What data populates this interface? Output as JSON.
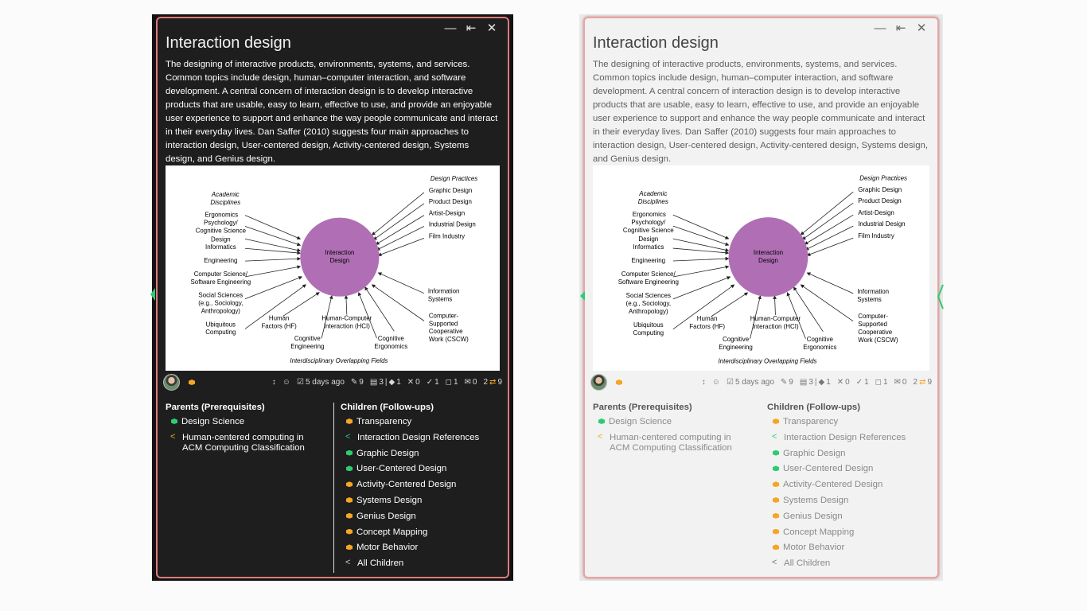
{
  "window_controls": {
    "minimize": "—",
    "restore": "⇤",
    "close": "✕"
  },
  "node": {
    "title": "Interaction design",
    "description": "The designing of interactive products, environments, systems, and services. Common topics include design, human–computer interaction, and software development. A central concern of interaction design is to develop interactive products that are usable, easy to learn, effective to use, and provide an enjoyable user experience to support and enhance the way people communicate and interact in their everyday lives. Dan Saffer (2010) suggests four main approaches to interaction design, User-centered design, Activity-centered design, Systems design, and Genius design."
  },
  "figure": {
    "center_line1": "Interaction",
    "center_line2": "Design",
    "academic_heading1": "Academic",
    "academic_heading2": "Disciplines",
    "practices_heading": "Design Practices",
    "fields_heading": "Interdisciplinary Overlapping Fields",
    "left_labels": [
      "Ergonomics",
      "Psychology/",
      "Cognitive Science",
      "Design",
      "Informatics",
      "Engineering",
      "Computer Science/",
      "Software Engineering",
      "Social Sciences",
      "(e.g., Sociology,",
      "Anthropology)",
      "Ubiquitous",
      "Computing"
    ],
    "right_labels": [
      "Graphic Design",
      "Product Design",
      "Artist-Design",
      "Industrial Design",
      "Film Industry",
      "Information",
      "Systems",
      "Computer-",
      "Supported",
      "Cooperative",
      "Work (CSCW)"
    ],
    "bottom_labels": [
      "Human",
      "Factors (HF)",
      "Cognitive",
      "Engineering",
      "Human-Computer",
      "Interaction (HCI)",
      "Cognitive",
      "Ergonomics"
    ],
    "circle_color": "#b06fb5"
  },
  "statusbar": {
    "updated": "5 days ago",
    "edits": "9",
    "resources": "3",
    "tags": "1",
    "rejected": "0",
    "accepted": "1",
    "bookmarks": "1",
    "messages": "0",
    "links": "2",
    "links_total": "9"
  },
  "parents": {
    "heading": "Parents (Prerequisites)",
    "items": [
      {
        "label": "Design Science",
        "icon": "cube-green-icon"
      },
      {
        "label": "Human-centered computing in ACM Computing Classification",
        "icon": "share-orange-icon"
      }
    ]
  },
  "children": {
    "heading": "Children (Follow-ups)",
    "items": [
      {
        "label": "Transparency",
        "icon": "cube-orange-icon"
      },
      {
        "label": "Interaction Design References",
        "icon": "share-green-icon"
      },
      {
        "label": "Graphic Design",
        "icon": "cube-green-icon"
      },
      {
        "label": "User-Centered Design",
        "icon": "cube-green-icon"
      },
      {
        "label": "Activity-Centered Design",
        "icon": "cube-orange-icon"
      },
      {
        "label": "Systems Design",
        "icon": "cube-orange-icon"
      },
      {
        "label": "Genius Design",
        "icon": "cube-orange-icon"
      },
      {
        "label": "Concept Mapping",
        "icon": "cube-orange-icon"
      },
      {
        "label": "Motor Behavior",
        "icon": "cube-orange-icon"
      },
      {
        "label": "All Children",
        "icon": "share-gray-icon"
      }
    ]
  },
  "colors": {
    "accent_border": "#e07a7a",
    "green": "#2ecc71",
    "orange": "#f5a623"
  }
}
